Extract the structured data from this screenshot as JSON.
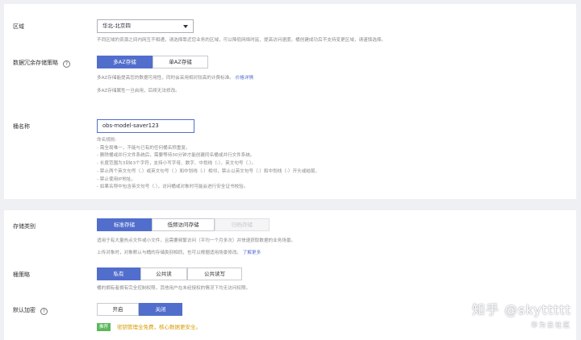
{
  "region": {
    "label": "区域",
    "value": "华北-北京四",
    "hint": "不同区域的资源之间内网互不相通，请选择靠近您业务的区域，可以降低网络时延、提高访问速度。桶创建成功后不支持变更区域，请谨慎选择。"
  },
  "redundancy": {
    "label": "数据冗余存储策略",
    "help_glyph": "?",
    "options": [
      "多AZ存储",
      "单AZ存储"
    ],
    "selected": "多AZ存储",
    "hint1": "多AZ存储能提高您的数据可用性，同时会采用相对较高的计费标准。",
    "hint1_link": "价格详情",
    "hint2": "多AZ存储属性一旦启用，后续无法修改。"
  },
  "bucket_name": {
    "label": "桶名称",
    "value": "obs-model-saver123",
    "rules": [
      "命名规则:",
      "- 需全局唯一，不能与已有的任何桶名称重复。",
      "- 删除桶或并行文件系统后，需要等待30分钟才能创建同名桶或并行文件系统。",
      "- 长度范围为3到63个字符，支持小写字母、数字、中划线（-）、英文句号（.）。",
      "- 禁止两个英文句号（.）或英文句号（.）和中划线（-）相邻，禁止以英文句号（.）和中划线（-）开头或结尾。",
      "- 禁止使用IP地址。",
      "- 如果名称中包含英文句号（.），访问桶或对象时可能会进行安全证书校验。"
    ]
  },
  "storage_class": {
    "label": "存储类别",
    "options": [
      "标准存储",
      "低频访问存储",
      "归档存储"
    ],
    "selected": "标准存储",
    "disabled": "归档存储",
    "hint1": "适用于有大量热点文件或小文件，且需要频繁访问（平均一个月多次）并快速获取数据的业务场景。",
    "hint2": "上传对象时，对象默认与桶的存储类别相同，也可以根据适用场景修改。",
    "hint2_link": "了解更多"
  },
  "bucket_policy": {
    "label": "桶策略",
    "options": [
      "私有",
      "公共读",
      "公共读写"
    ],
    "selected": "私有",
    "hint": "桶的拥有者拥有完全控制权限，其他用户在未经授权的情况下均无访问权限。"
  },
  "encryption": {
    "label": "默认加密",
    "help_glyph": "?",
    "options": [
      "开启",
      "关闭"
    ],
    "selected": "关闭",
    "tag": "推荐",
    "note": "密钥管理全免费，核心数据更安全。"
  },
  "watermark": {
    "line1": "知乎 @skyttttt",
    "line2": "华为云社区"
  },
  "colors": {
    "accent": "#526ecc",
    "tag_green": "#5cb85c",
    "note_orange": "#d79b00"
  }
}
